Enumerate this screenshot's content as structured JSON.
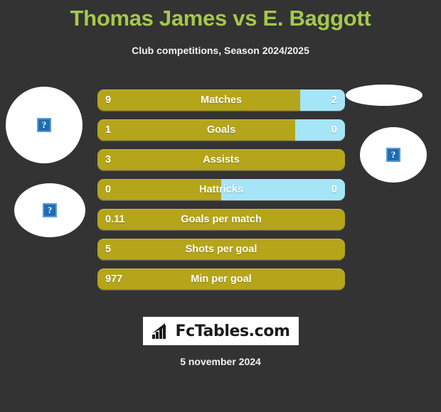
{
  "header": {
    "title": "Thomas James vs E. Baggott",
    "subtitle": "Club competitions, Season 2024/2025",
    "title_color": "#a5c84b"
  },
  "theme": {
    "background": "#333333",
    "home_color": "#b5a51a",
    "away_color": "#a5e5f8",
    "text_color": "#ffffff"
  },
  "avatars": [
    {
      "name": "home-player-photo-top",
      "placeholder": "?"
    },
    {
      "name": "home-player-photo-bottom",
      "placeholder": "?"
    },
    {
      "name": "away-player-photo-top",
      "placeholder": ""
    },
    {
      "name": "away-player-photo-bottom",
      "placeholder": "?"
    }
  ],
  "chart_data": {
    "type": "bar",
    "title": "Thomas James vs E. Baggott",
    "subtitle": "Club competitions, Season 2024/2025",
    "orientation": "horizontal-diverging",
    "series": [
      {
        "name": "Thomas James",
        "color": "#b5a51a"
      },
      {
        "name": "E. Baggott",
        "color": "#a5e5f8"
      }
    ],
    "categories": [
      "Matches",
      "Goals",
      "Assists",
      "Hattricks",
      "Goals per match",
      "Shots per goal",
      "Min per goal"
    ],
    "rows": [
      {
        "label": "Matches",
        "home_value": "9",
        "away_value": "2",
        "home_pct": 81.8,
        "away_pct": 18.2,
        "has_away": true
      },
      {
        "label": "Goals",
        "home_value": "1",
        "away_value": "0",
        "home_pct": 80.0,
        "away_pct": 20.0,
        "has_away": true
      },
      {
        "label": "Assists",
        "home_value": "3",
        "away_value": "",
        "home_pct": 100.0,
        "away_pct": 0.0,
        "has_away": false
      },
      {
        "label": "Hattricks",
        "home_value": "0",
        "away_value": "0",
        "home_pct": 50.0,
        "away_pct": 50.0,
        "has_away": true
      },
      {
        "label": "Goals per match",
        "home_value": "0.11",
        "away_value": "",
        "home_pct": 100.0,
        "away_pct": 0.0,
        "has_away": false
      },
      {
        "label": "Shots per goal",
        "home_value": "5",
        "away_value": "",
        "home_pct": 100.0,
        "away_pct": 0.0,
        "has_away": false
      },
      {
        "label": "Min per goal",
        "home_value": "977",
        "away_value": "",
        "home_pct": 100.0,
        "away_pct": 0.0,
        "has_away": false
      }
    ]
  },
  "footer": {
    "logo_text": "FcTables.com",
    "logo_icon": "bar-chart-icon",
    "date": "5 november 2024"
  }
}
